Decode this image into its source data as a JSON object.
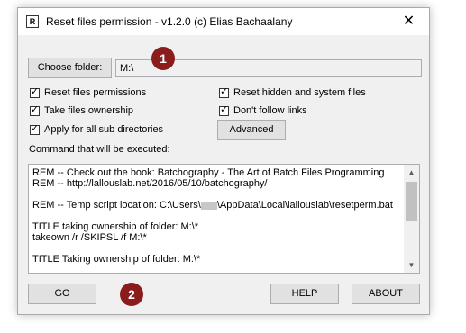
{
  "window": {
    "title": "Reset files permission - v1.2.0 (c) Elias Bachaalany",
    "icon_letter": "R",
    "close_glyph": "✕"
  },
  "toolbar": {
    "choose_folder_label": "Choose folder:",
    "path_value": "M:\\"
  },
  "badges": {
    "badge1": "1",
    "badge2": "2"
  },
  "options": {
    "reset_permissions": {
      "label": "Reset files permissions",
      "checked": true
    },
    "take_ownership": {
      "label": "Take files ownership",
      "checked": true
    },
    "apply_subdirs": {
      "label": "Apply for all sub directories",
      "checked": true
    },
    "reset_hidden": {
      "label": "Reset hidden and system files",
      "checked": true
    },
    "dont_follow_links": {
      "label": "Don't follow links",
      "checked": true
    },
    "advanced_label": "Advanced",
    "check_glyph": "✓"
  },
  "command": {
    "heading": "Command that will be executed:",
    "lines": [
      "REM -- Check out the book: Batchography - The Art of Batch Files Programming",
      "REM -- http://lallouslab.net/2016/05/10/batchography/",
      "",
      "REM -- Temp script location: C:\\Users\\",
      "",
      "TITLE taking ownership of folder: M:\\*",
      "takeown /r  /SKIPSL  /f M:\\*",
      "",
      "TITLE Taking ownership of folder: M:\\*"
    ],
    "temp_suffix": "\\AppData\\Local\\lallouslab\\resetperm.bat"
  },
  "buttons": {
    "go_label": "GO",
    "help_label": "HELP",
    "about_label": "ABOUT"
  }
}
